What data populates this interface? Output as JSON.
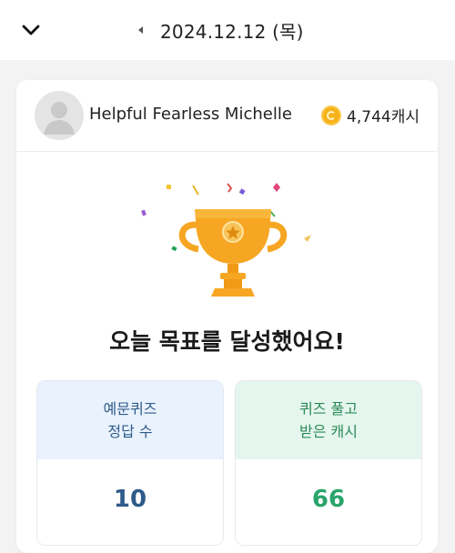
{
  "topbar": {
    "date": "2024.12.12 (목)",
    "collapse_icon": "chevron-down-icon",
    "prev_icon": "caret-left-icon"
  },
  "profile": {
    "name": "Helpful Fearless Michelle",
    "cash": "4,744캐시",
    "coin_icon": "coin-icon",
    "avatar_icon": "avatar-placeholder-icon"
  },
  "achievement": {
    "title": "오늘 목표를 달성했어요!",
    "trophy_icon": "trophy-icon"
  },
  "stats": {
    "quiz_correct": {
      "label_line1": "예문퀴즈",
      "label_line2": "정답 수",
      "value": "10"
    },
    "quiz_cash": {
      "label_line1": "퀴즈 풀고",
      "label_line2": "받은 캐시",
      "value": "66"
    }
  },
  "colors": {
    "accent_blue": "#2f5b8a",
    "accent_green": "#2aa46a",
    "trophy_orange": "#f6a623",
    "coin_gold": "#f6b21b"
  }
}
